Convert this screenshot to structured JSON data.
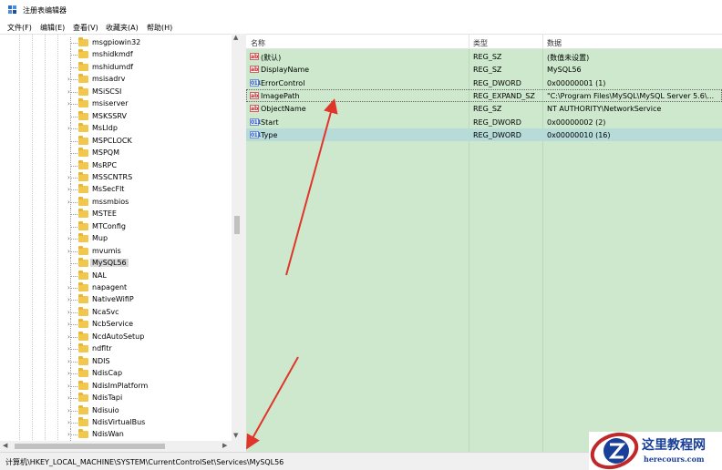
{
  "window": {
    "title": "注册表编辑器",
    "app_icon": "registry-editor-icon"
  },
  "menu": [
    "文件(F)",
    "编辑(E)",
    "查看(V)",
    "收藏夹(A)",
    "帮助(H)"
  ],
  "tree": {
    "items": [
      {
        "label": "msgpiowin32",
        "expandable": false
      },
      {
        "label": "mshidkmdf",
        "expandable": false
      },
      {
        "label": "mshidumdf",
        "expandable": false
      },
      {
        "label": "msisadrv",
        "expandable": true
      },
      {
        "label": "MSiSCSI",
        "expandable": true
      },
      {
        "label": "msiserver",
        "expandable": true
      },
      {
        "label": "MSKSSRV",
        "expandable": false
      },
      {
        "label": "MsLldp",
        "expandable": true
      },
      {
        "label": "MSPCLOCK",
        "expandable": false
      },
      {
        "label": "MSPQM",
        "expandable": false
      },
      {
        "label": "MsRPC",
        "expandable": false
      },
      {
        "label": "MSSCNTRS",
        "expandable": true
      },
      {
        "label": "MsSecFlt",
        "expandable": true
      },
      {
        "label": "mssmbios",
        "expandable": true
      },
      {
        "label": "MSTEE",
        "expandable": false
      },
      {
        "label": "MTConfig",
        "expandable": false
      },
      {
        "label": "Mup",
        "expandable": true
      },
      {
        "label": "mvumis",
        "expandable": true
      },
      {
        "label": "MySQL56",
        "expandable": false,
        "selected": true
      },
      {
        "label": "NAL",
        "expandable": false
      },
      {
        "label": "napagent",
        "expandable": true
      },
      {
        "label": "NativeWifiP",
        "expandable": true
      },
      {
        "label": "NcaSvc",
        "expandable": true
      },
      {
        "label": "NcbService",
        "expandable": true
      },
      {
        "label": "NcdAutoSetup",
        "expandable": true
      },
      {
        "label": "ndfltr",
        "expandable": true
      },
      {
        "label": "NDIS",
        "expandable": true
      },
      {
        "label": "NdisCap",
        "expandable": true
      },
      {
        "label": "NdisImPlatform",
        "expandable": true
      },
      {
        "label": "NdisTapi",
        "expandable": true
      },
      {
        "label": "Ndisuio",
        "expandable": true
      },
      {
        "label": "NdisVirtualBus",
        "expandable": true
      },
      {
        "label": "NdisWan",
        "expandable": true
      }
    ]
  },
  "values": {
    "columns": [
      "名称",
      "类型",
      "数据"
    ],
    "rows": [
      {
        "icon": "string-value-icon",
        "name": "(默认)",
        "type": "REG_SZ",
        "data": "(数值未设置)"
      },
      {
        "icon": "string-value-icon",
        "name": "DisplayName",
        "type": "REG_SZ",
        "data": "MySQL56"
      },
      {
        "icon": "binary-value-icon",
        "name": "ErrorControl",
        "type": "REG_DWORD",
        "data": "0x00000001 (1)"
      },
      {
        "icon": "string-value-icon",
        "name": "ImagePath",
        "type": "REG_EXPAND_SZ",
        "data": "\"C:\\Program Files\\MySQL\\MySQL Server 5.6\\...",
        "focused": true
      },
      {
        "icon": "string-value-icon",
        "name": "ObjectName",
        "type": "REG_SZ",
        "data": "NT AUTHORITY\\NetworkService"
      },
      {
        "icon": "binary-value-icon",
        "name": "Start",
        "type": "REG_DWORD",
        "data": "0x00000002 (2)"
      },
      {
        "icon": "binary-value-icon",
        "name": "Type",
        "type": "REG_DWORD",
        "data": "0x00000010 (16)",
        "selected": true
      }
    ]
  },
  "statusbar": {
    "path": "计算机\\HKEY_LOCAL_MACHINE\\SYSTEM\\CurrentControlSet\\Services\\MySQL56"
  },
  "watermark": {
    "text": "这里教程网",
    "url": "herecours.com",
    "logo": "z-logo-icon"
  },
  "colors": {
    "values_bg": "#cde8cc",
    "selected_row": "#b6dbd9",
    "annotation_arrow": "#e0352b",
    "watermark_blue": "#1a3f98"
  }
}
